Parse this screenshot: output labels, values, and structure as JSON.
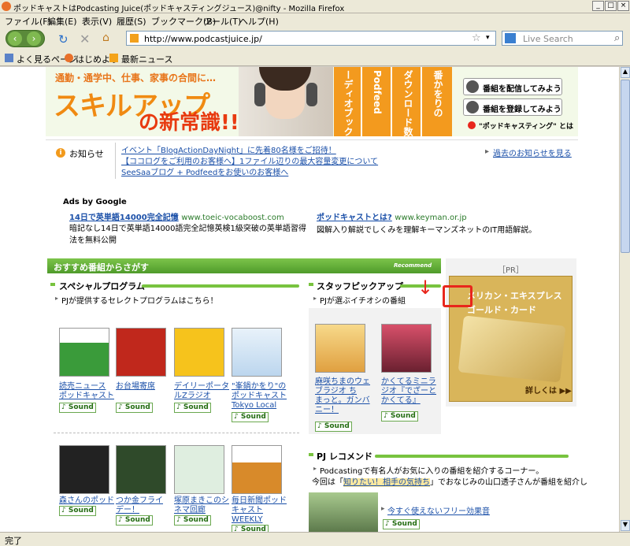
{
  "window": {
    "title": "ポッドキャストはPodcasting Juice(ポッドキャスティングジュース)@nifty - Mozilla Firefox"
  },
  "menu": [
    "ファイル(F)",
    "編集(E)",
    "表示(V)",
    "履歴(S)",
    "ブックマーク(B)",
    "ツール(T)",
    "ヘルプ(H)"
  ],
  "nav": {
    "url": "http://www.podcastjuice.jp/",
    "search_placeholder": "Live Search"
  },
  "bookmarks": [
    "よく見るページ",
    "はじめよう",
    "最新ニュース"
  ],
  "banner": {
    "tagline": "通勤・通学中、仕事、家事の合間に…",
    "headline1": "スキルアップ",
    "headline2": "の新常識!!",
    "col1": "ーディオブック",
    "col2": "Podfeed",
    "col3": "ダウンロード数",
    "col4": "番かをりの",
    "btn1": "番組を配信してみよう",
    "btn2": "番組を登録してみよう",
    "caption": "\"ポッドキャスティング\" とは"
  },
  "notices": {
    "label": "お知らせ",
    "items": [
      "イベント「BlogActionDayNight」に先着80名様をご招待！",
      "【ココログをご利用のお客様へ】1ファイル辺りの最大容量変更について",
      "SeeSaaブログ + Podfeedをお使いのお客様へ"
    ],
    "past": "過去のお知らせを見る"
  },
  "ads": {
    "title": "Ads by Google",
    "ad1_title": "14日で英単語14000完全記憶",
    "ad1_url": "www.toeic-vocaboost.com",
    "ad1_desc": "暗記なし14日で英単語14000語完全記憶英検1級突破の英単語習得法を無料公開",
    "ad2_title": "ポッドキャストとは?",
    "ad2_url": "www.keyman.or.jp",
    "ad2_desc": "図解入り解説でしくみを理解キーマンズネットのIT用語解説。"
  },
  "recommend": {
    "bar": "おすすめ番組からさがす",
    "badge": "Recommend"
  },
  "special": {
    "title": "スペシャルプログラム",
    "sub": "PJが提供するセレクトプログラムはこちら！",
    "items": [
      [
        "読売ニュース",
        "ポッドキャスト"
      ],
      [
        "お台場寄席"
      ],
      [
        "デイリーポータ",
        "ルZラジオ"
      ],
      [
        "\"峯鍋かをり\"の",
        "ポッドキャスト",
        "Tokyo Local"
      ],
      [
        "森さんのポッド"
      ],
      [
        "つか金フライ",
        "デー！"
      ],
      [
        "塚原まきこのシ",
        "ネマ回廊"
      ],
      [
        "毎日新聞ポッド",
        "キャスト",
        "WEEKLY"
      ]
    ],
    "sound": "Sound"
  },
  "staff": {
    "title": "スタッフピックアップ",
    "sub": "PJが選ぶイチオシの番組",
    "items": [
      [
        "麻咲ちまのウェ",
        "ブラジオ ち",
        "まっと。ガンバ",
        "ニー！"
      ],
      [
        "かくてるミニラ",
        "ジオ『でざーと",
        "かくてる』"
      ]
    ]
  },
  "pr": {
    "label": "［PR］",
    "card1": "メリカン・エキスプレス",
    "card2": "ゴールド・カード",
    "more": "詳しくは ▶▶"
  },
  "pjrec": {
    "title": "PJ レコメンド",
    "desc": "Podcastingで有名人がお気に入りの番組を紹介するコーナー。",
    "desc2a": "今回は「",
    "desc2link": "知りたい！相手の気持ち",
    "desc2b": "」でおなじみの山口透子さんが番組を紹介し",
    "item": "今すぐ使えないフリー効果音"
  },
  "status": "完了",
  "colors": {
    "green": "#5aad2e",
    "orange": "#f29a1c",
    "link": "#1a4fa8",
    "red": "#e8261c"
  }
}
